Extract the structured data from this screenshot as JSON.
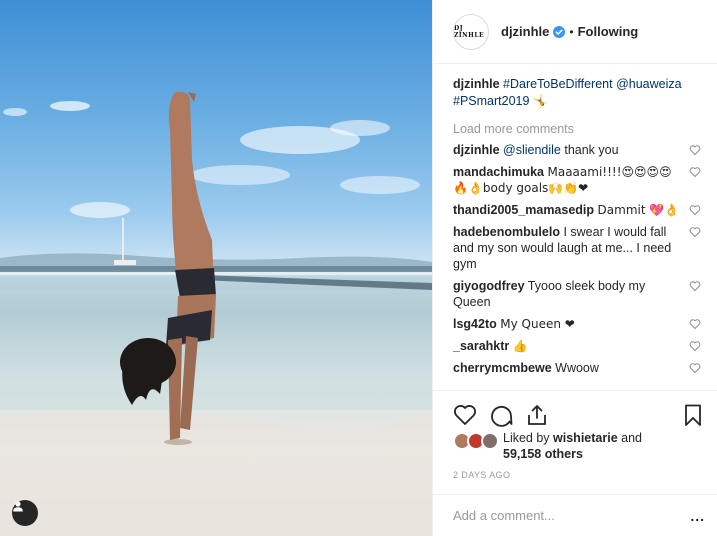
{
  "post": {
    "username": "djzinhle",
    "avatar_logo": "DJ ZINHLE",
    "follow_status": "Following",
    "caption": {
      "user": "djzinhle",
      "hashtag1": "#DareToBeDifferent",
      "mention": "@huaweiza",
      "hashtag2": "#PSmart2019",
      "emoji": "🤸"
    }
  },
  "load_more": "Load more comments",
  "comments": [
    {
      "user": "djzinhle",
      "mention": "@sliendile",
      "text": " thank you"
    },
    {
      "user": "mandachimuka",
      "text": "Maaaami!!!!😍😍😍😍🔥👌body goals🙌👏❤"
    },
    {
      "user": "thandi2005_mamasedip",
      "text": "Dammit 💖👌"
    },
    {
      "user": "hadebenombulelo",
      "text": "I swear I would fall and my son would laugh at me... I need gym"
    },
    {
      "user": "giyogodfrey",
      "text": "Tyooo sleek body my Queen"
    },
    {
      "user": "lsg42to",
      "text": "My Queen ❤"
    },
    {
      "user": "_sarahktr",
      "text": "👍"
    },
    {
      "user": "cherrymcmbewe",
      "text": "Wwoow"
    }
  ],
  "likes": {
    "prefix": "Liked by ",
    "user": "wishietarie",
    "and": " and",
    "others": "59,158 others"
  },
  "timestamp": "2 DAYS AGO",
  "add_comment_placeholder": "Add a comment...",
  "more_label": "...",
  "icons": {
    "like": "heart-icon",
    "comment": "comment-icon",
    "share": "share-icon",
    "save": "bookmark-icon",
    "verified": "verified-badge-icon",
    "profile": "user-icon"
  },
  "colors": {
    "link": "#003569",
    "verified": "#3897f0",
    "muted": "#999999"
  }
}
